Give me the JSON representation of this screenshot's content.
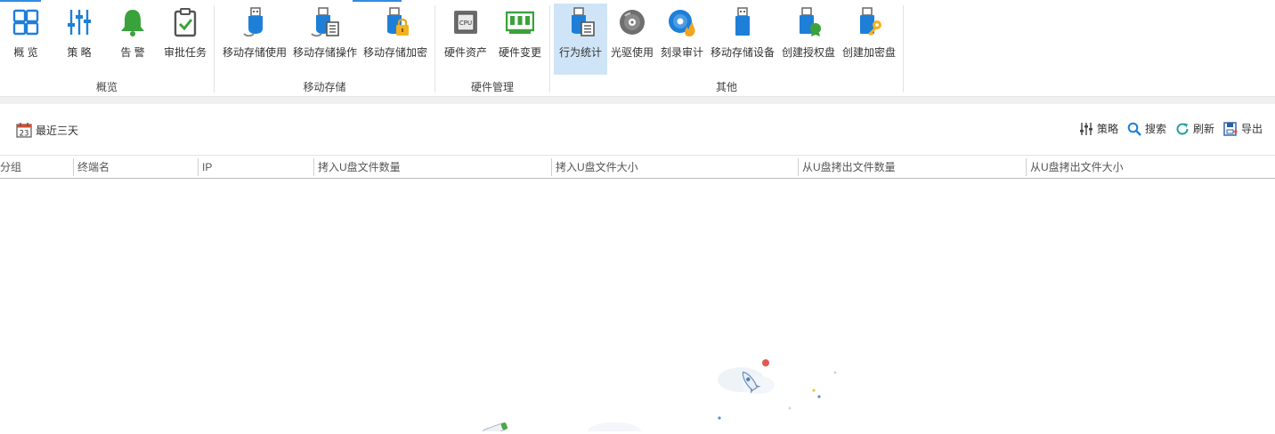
{
  "ribbon": {
    "groups": [
      {
        "label": "概览",
        "buttons": [
          {
            "label": "概 览",
            "icon": "overview-grid-icon"
          },
          {
            "label": "策 略",
            "icon": "policy-sliders-icon"
          },
          {
            "label": "告 警",
            "icon": "alarm-bell-icon"
          },
          {
            "label": "审批任务",
            "icon": "approval-clipboard-icon"
          }
        ]
      },
      {
        "label": "移动存储",
        "buttons": [
          {
            "label": "移动存储使用",
            "icon": "usb-use-icon"
          },
          {
            "label": "移动存储操作",
            "icon": "usb-operation-icon"
          },
          {
            "label": "移动存储加密",
            "icon": "usb-encrypt-icon"
          }
        ]
      },
      {
        "label": "硬件管理",
        "buttons": [
          {
            "label": "硬件资产",
            "icon": "cpu-icon"
          },
          {
            "label": "硬件变更",
            "icon": "memory-board-icon"
          }
        ]
      },
      {
        "label": "其他",
        "buttons": [
          {
            "label": "行为统计",
            "icon": "usb-statistics-icon",
            "active": true
          },
          {
            "label": "光驱使用",
            "icon": "disc-icon"
          },
          {
            "label": "刻录审计",
            "icon": "disc-burn-icon"
          },
          {
            "label": "移动存储设备",
            "icon": "usb-device-icon"
          },
          {
            "label": "创建授权盘",
            "icon": "usb-authorize-icon"
          },
          {
            "label": "创建加密盘",
            "icon": "usb-key-icon"
          }
        ]
      }
    ]
  },
  "toolbar": {
    "date_filter": "最近三天",
    "calendar_day": "23",
    "actions": [
      "策略",
      "搜索",
      "刷新",
      "导出"
    ]
  },
  "table": {
    "columns": [
      "分组",
      "终端名",
      "IP",
      "拷入U盘文件数量",
      "拷入U盘文件大小",
      "从U盘拷出文件数量",
      "从U盘拷出文件大小"
    ],
    "rows": []
  },
  "colors": {
    "accent": "#2e8ce0",
    "active_bg": "#cfe5f7",
    "icon_blue": "#1e7fd8",
    "icon_green": "#3aa23a"
  }
}
